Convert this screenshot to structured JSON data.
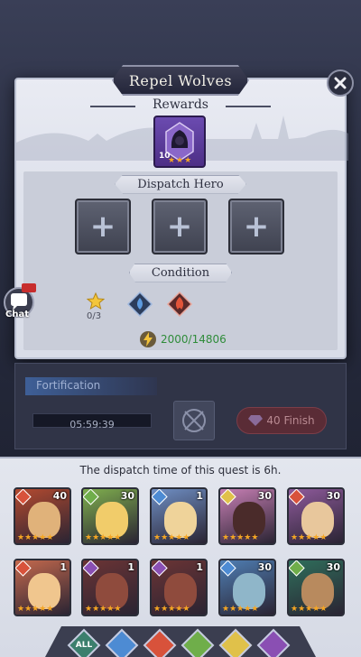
{
  "quest": {
    "title": "Repel Wolves",
    "rewards_label": "Rewards",
    "reward_item": {
      "icon": "hooded-figure-icon",
      "count": "10",
      "stars": 3
    },
    "dispatch_label": "Dispatch Hero",
    "slots": [
      "add-hero-slot-1",
      "add-hero-slot-2",
      "add-hero-slot-3"
    ],
    "condition_label": "Condition",
    "star_progress": "0/3",
    "condition_elements": [
      "water",
      "fire"
    ],
    "power": "2000/14806"
  },
  "chat": {
    "label": "Chat"
  },
  "fortification": {
    "label": "Fortification",
    "timer": "05:59:39",
    "finish_cost": "40",
    "finish_label": "Finish",
    "finish_text": "40 Finish"
  },
  "hero_picker": {
    "notice": "The dispatch time of this quest is 6h.",
    "heroes": [
      {
        "level": "40",
        "stars": 5,
        "element": "fire",
        "palette": [
          "#b34a2f",
          "#e0b27a"
        ]
      },
      {
        "level": "30",
        "stars": 5,
        "element": "earth",
        "palette": [
          "#7fae4e",
          "#f1cc6a"
        ]
      },
      {
        "level": "1",
        "stars": 5,
        "element": "water",
        "palette": [
          "#6f8fc4",
          "#efd39a"
        ]
      },
      {
        "level": "30",
        "stars": 5,
        "element": "light",
        "palette": [
          "#c77fb4",
          "#4a2b2a"
        ]
      },
      {
        "level": "30",
        "stars": 5,
        "element": "fire",
        "palette": [
          "#8e5a9b",
          "#e8c79c"
        ]
      },
      {
        "level": "1",
        "stars": 5,
        "element": "fire",
        "palette": [
          "#c4694d",
          "#f0c68e"
        ]
      },
      {
        "level": "1",
        "stars": 5,
        "element": "dark",
        "palette": [
          "#6b3434",
          "#8f4b3d"
        ]
      },
      {
        "level": "1",
        "stars": 5,
        "element": "dark",
        "palette": [
          "#6b3434",
          "#8f4b3d"
        ]
      },
      {
        "level": "30",
        "stars": 5,
        "element": "water",
        "palette": [
          "#4f7eb3",
          "#8fb6c9"
        ]
      },
      {
        "level": "30",
        "stars": 5,
        "element": "earth",
        "palette": [
          "#2f6e5b",
          "#b88a5e"
        ]
      }
    ],
    "filters": [
      "ALL",
      "water",
      "fire",
      "earth",
      "light",
      "dark"
    ],
    "filter_all_label": "ALL"
  },
  "colors": {
    "star": "#f5a623",
    "power": "#2f8c3a",
    "water": "#4d8bd3",
    "fire": "#d8523b",
    "earth": "#6fae4a",
    "light": "#e0c14a",
    "dark": "#8a4fb3"
  }
}
